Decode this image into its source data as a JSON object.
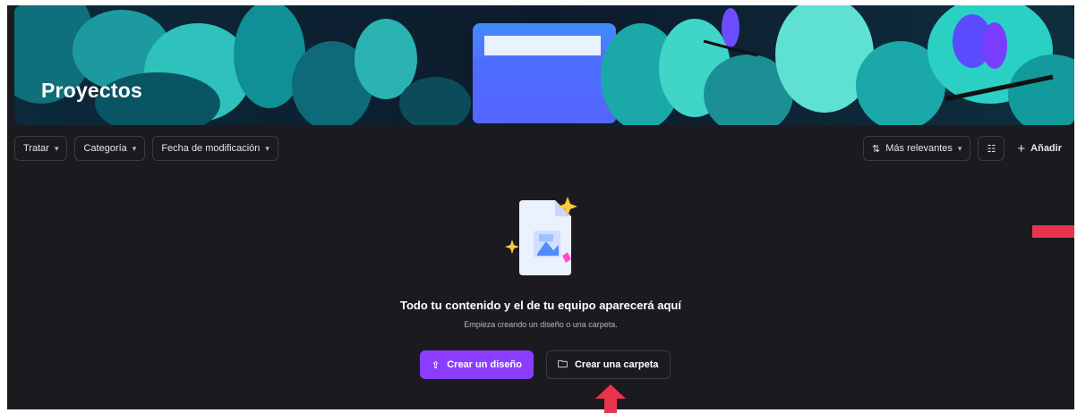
{
  "banner": {
    "title": "Proyectos"
  },
  "filters": [
    {
      "label": "Tratar"
    },
    {
      "label": "Categoría"
    },
    {
      "label": "Fecha de modificación"
    }
  ],
  "toolbar": {
    "sort_label": "Más relevantes",
    "add_label": "Añadir"
  },
  "empty_state": {
    "title": "Todo tu contenido y el de tu equipo aparecerá aquí",
    "subtitle": "Empieza creando un diseño o una carpeta.",
    "create_design_label": "Crear un diseño",
    "create_folder_label": "Crear una carpeta"
  },
  "colors": {
    "background": "#1b1b1f",
    "accent": "#8b3dff",
    "marker": "#e8344e",
    "banner_teal": "#27c9c0"
  },
  "icons": [
    "chevron-down-icon",
    "sort-icon",
    "grid-view-icon",
    "plus-icon",
    "upload-icon",
    "folder-icon"
  ]
}
